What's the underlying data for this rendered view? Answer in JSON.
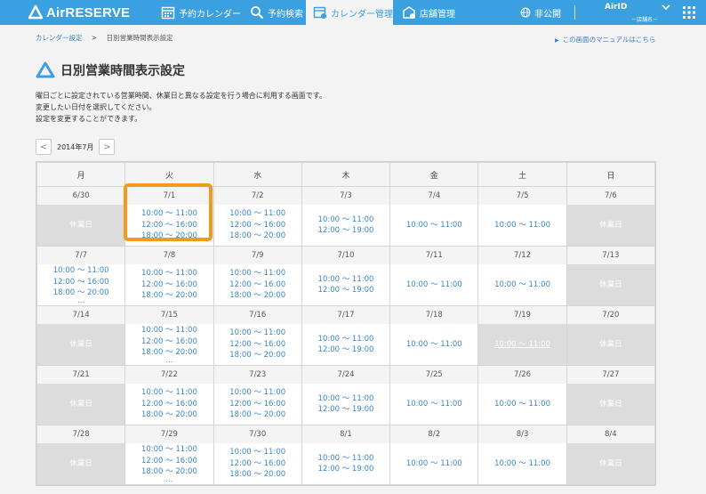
{
  "header": {
    "logo_text": "AirRESERVE",
    "nav": [
      {
        "label": "予約カレンダー",
        "icon": "calendar-grid-icon"
      },
      {
        "label": "予約検索",
        "icon": "search-icon"
      },
      {
        "label": "カレンダー管理",
        "icon": "calendar-settings-icon"
      },
      {
        "label": "店舗管理",
        "icon": "store-settings-icon"
      },
      {
        "label": "非公開",
        "icon": "globe-icon"
      }
    ],
    "airid": "AirID",
    "store_name": "－店舗名－"
  },
  "breadcrumb": {
    "parent": "カレンダー設定",
    "separator": ">",
    "current": "日別営業時間表示設定"
  },
  "manual_link": "この画面のマニュアルはこちら",
  "page_title": "日別営業時間表示設定",
  "description": [
    "曜日ごとに設定されている営業時間、休業日と異なる設定を行う場合に利用する画面です。",
    "変更したい日付を選択してください。",
    "設定を変更することができます。"
  ],
  "month_nav": {
    "prev": "<",
    "label": "2014年7月",
    "next": ">"
  },
  "calendar": {
    "weekdays": [
      "月",
      "火",
      "水",
      "木",
      "金",
      "土",
      "日"
    ],
    "weeks": [
      {
        "dates": [
          "6/30",
          "7/1",
          "7/2",
          "7/3",
          "7/4",
          "7/5",
          "7/6"
        ],
        "slots": [
          {
            "closed": true,
            "text": "休業日"
          },
          {
            "lines": [
              "10:00 ～ 11:00",
              "12:00 ～ 16:00",
              "18:00 ～ 20:00"
            ]
          },
          {
            "lines": [
              "10:00 ～ 11:00",
              "12:00 ～ 16:00",
              "18:00 ～ 20:00"
            ]
          },
          {
            "lines": [
              "10:00 ～ 11:00",
              "12:00 ～ 19:00"
            ]
          },
          {
            "lines": [
              "10:00 ～ 11:00"
            ]
          },
          {
            "lines": [
              "10:00 ～ 11:00"
            ]
          },
          {
            "closed": true,
            "text": "休業日"
          }
        ]
      },
      {
        "dates": [
          "7/7",
          "7/8",
          "7/9",
          "7/10",
          "7/11",
          "7/12",
          "7/13"
        ],
        "slots": [
          {
            "lines": [
              "10:00 ～ 11:00",
              "12:00 ～ 16:00",
              "18:00 ～ 20:00"
            ],
            "more": "..."
          },
          {
            "lines": [
              "10:00 ～ 11:00",
              "12:00 ～ 16:00",
              "18:00 ～ 20:00"
            ]
          },
          {
            "lines": [
              "10:00 ～ 11:00",
              "12:00 ～ 16:00",
              "18:00 ～ 20:00"
            ]
          },
          {
            "lines": [
              "10:00 ～ 11:00",
              "12:00 ～ 19:00"
            ]
          },
          {
            "lines": [
              "10:00 ～ 11:00"
            ]
          },
          {
            "lines": [
              "10:00 ～ 11:00"
            ]
          },
          {
            "closed": true,
            "text": "休業日"
          }
        ]
      },
      {
        "dates": [
          "7/14",
          "7/15",
          "7/16",
          "7/17",
          "7/18",
          "7/19",
          "7/20"
        ],
        "slots": [
          {
            "closed": true,
            "text": "休業日"
          },
          {
            "lines": [
              "10:00 ～ 11:00",
              "12:00 ～ 16:00",
              "18:00 ～ 20:00"
            ],
            "more": "..."
          },
          {
            "lines": [
              "10:00 ～ 11:00",
              "12:00 ～ 16:00",
              "18:00 ～ 20:00"
            ]
          },
          {
            "lines": [
              "10:00 ～ 11:00",
              "12:00 ～ 19:00"
            ]
          },
          {
            "lines": [
              "10:00 ～ 11:00"
            ]
          },
          {
            "greyed": true,
            "lines": [
              "10:00 ～ 11:00"
            ]
          },
          {
            "closed": true,
            "text": "休業日"
          }
        ]
      },
      {
        "dates": [
          "7/21",
          "7/22",
          "7/23",
          "7/24",
          "7/25",
          "7/26",
          "7/27"
        ],
        "slots": [
          {
            "closed": true,
            "text": "休業日"
          },
          {
            "lines": [
              "10:00 ～ 11:00",
              "12:00 ～ 16:00",
              "18:00 ～ 20:00"
            ]
          },
          {
            "lines": [
              "10:00 ～ 11:00",
              "12:00 ～ 16:00",
              "18:00 ～ 20:00"
            ]
          },
          {
            "lines": [
              "10:00 ～ 11:00",
              "12:00 ～ 19:00"
            ]
          },
          {
            "lines": [
              "10:00 ～ 11:00"
            ]
          },
          {
            "lines": [
              "10:00 ～ 11:00"
            ]
          },
          {
            "closed": true,
            "text": "休業日"
          }
        ]
      },
      {
        "dates": [
          "7/28",
          "7/29",
          "7/30",
          "8/1",
          "8/2",
          "8/3",
          "8/4"
        ],
        "slots": [
          {
            "closed": true,
            "text": "休業日"
          },
          {
            "lines": [
              "10:00 ～ 11:00",
              "12:00 ～ 16:00",
              "18:00 ～ 20:00"
            ],
            "more": "..."
          },
          {
            "lines": [
              "10:00 ～ 11:00",
              "12:00 ～ 16:00",
              "18:00 ～ 20:00"
            ]
          },
          {
            "lines": [
              "10:00 ～ 11:00",
              "12:00 ～ 19:00"
            ]
          },
          {
            "lines": [
              "10:00 ～ 11:00"
            ]
          },
          {
            "lines": [
              "10:00 ～ 11:00"
            ]
          },
          {
            "closed": true,
            "text": "休業日"
          }
        ]
      }
    ]
  },
  "colors": {
    "header": "#3ba0e0",
    "link": "#3a86c6",
    "highlight": "#f29a1e",
    "closed": "#dcdcdc"
  }
}
